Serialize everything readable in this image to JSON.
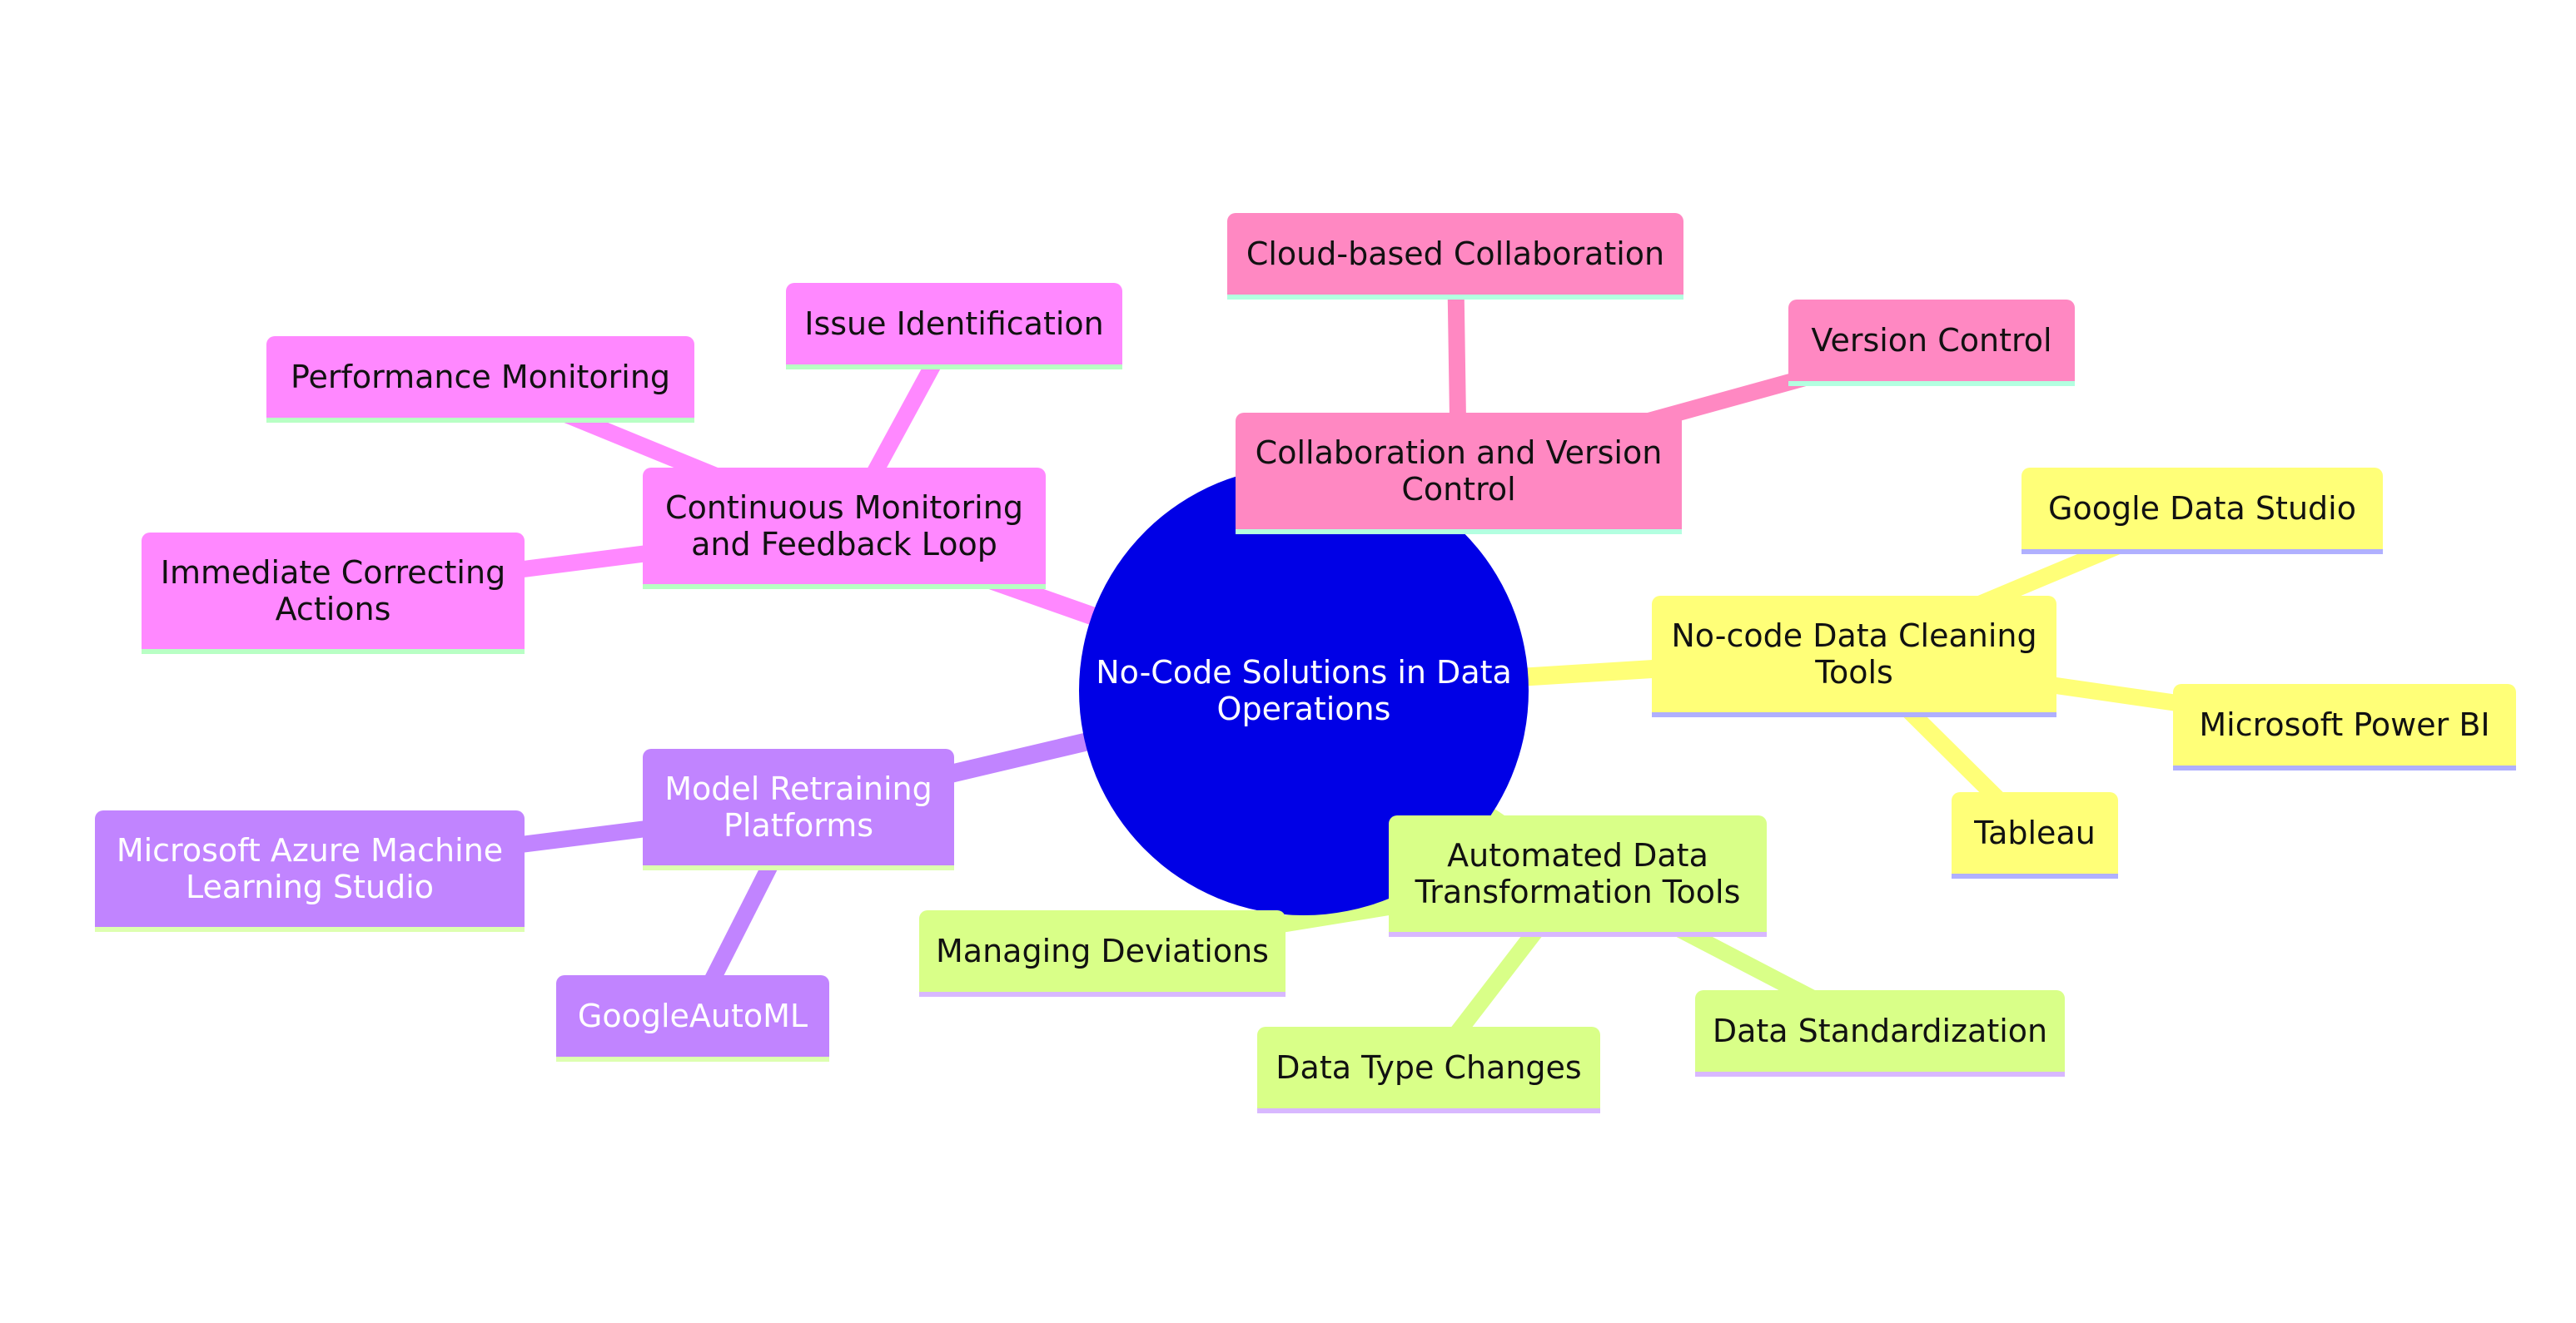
{
  "title": "No-Code Solutions in Data Operations",
  "colors": {
    "root": "#0000e6",
    "monitoring": "#ff88ff",
    "retraining": "#c184ff",
    "collaboration": "#ff88c2",
    "cleaning": "#ffff78",
    "transformation": "#d9ff88",
    "underline_green": "#b8ffc4",
    "underline_mint": "#b3ffe0",
    "underline_lavender": "#b0b0ff",
    "underline_lilac": "#d8b8ff",
    "underline_lime": "#ddffb0"
  },
  "root": {
    "label": "No-Code Solutions in Data Operations"
  },
  "branches": [
    {
      "id": "monitoring",
      "label": "Continuous Monitoring and Feedback Loop",
      "children": [
        "Issue Identification",
        "Performance Monitoring",
        "Immediate Correcting Actions"
      ]
    },
    {
      "id": "retraining",
      "label": "Model Retraining Platforms",
      "children": [
        "Microsoft Azure Machine Learning Studio",
        "GoogleAutoML"
      ]
    },
    {
      "id": "collaboration",
      "label": "Collaboration and Version Control",
      "children": [
        "Cloud-based Collaboration",
        "Version Control"
      ]
    },
    {
      "id": "cleaning",
      "label": "No-code Data Cleaning Tools",
      "children": [
        "Google Data Studio",
        "Microsoft Power BI",
        "Tableau"
      ]
    },
    {
      "id": "transformation",
      "label": "Automated Data Transformation Tools",
      "children": [
        "Managing Deviations",
        "Data Type Changes",
        "Data Standardization"
      ]
    }
  ]
}
